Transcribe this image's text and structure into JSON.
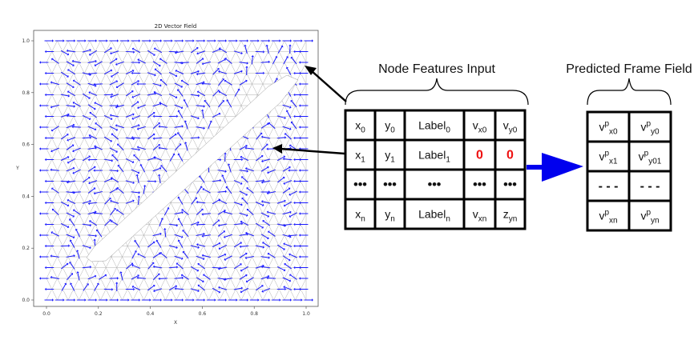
{
  "plot": {
    "title": "2D Vector Field",
    "xlabel": "X",
    "ylabel": "Y",
    "xticks": [
      "0.0",
      "0.2",
      "0.4",
      "0.6",
      "0.8",
      "1.0"
    ],
    "yticks": [
      "0.0",
      "0.2",
      "0.4",
      "0.6",
      "0.8",
      "1.0"
    ],
    "arrow_color": "#1a1aff",
    "mesh_color": "#9a9a9a"
  },
  "input_table": {
    "title": "Node Features Input",
    "rows": [
      [
        {
          "main": "x",
          "sub": "0"
        },
        {
          "main": "y",
          "sub": "0"
        },
        {
          "main": "Label",
          "sub": "0"
        },
        {
          "main": "v",
          "sub": "x0"
        },
        {
          "main": "v",
          "sub": "y0"
        }
      ],
      [
        {
          "main": "x",
          "sub": "1"
        },
        {
          "main": "y",
          "sub": "1"
        },
        {
          "main": "Label",
          "sub": "1"
        },
        {
          "main": "0",
          "red": true
        },
        {
          "main": "0",
          "red": true
        }
      ],
      [
        {
          "main": "•••",
          "dots": true
        },
        {
          "main": "•••",
          "dots": true
        },
        {
          "main": "•••",
          "dots": true
        },
        {
          "main": "•••",
          "dots": true
        },
        {
          "main": "•••",
          "dots": true
        }
      ],
      [
        {
          "main": "x",
          "sub": "n"
        },
        {
          "main": "y",
          "sub": "n"
        },
        {
          "main": "Label",
          "sub": "n"
        },
        {
          "main": "v",
          "sub": "xn"
        },
        {
          "main": "z",
          "sub": "yn"
        }
      ]
    ]
  },
  "output_table": {
    "title": "Predicted Frame Field",
    "rows": [
      [
        {
          "main": "v",
          "sup": "p",
          "sub": "x0"
        },
        {
          "main": "v",
          "sup": "p",
          "sub": "y0"
        }
      ],
      [
        {
          "main": "v",
          "sup": "p",
          "sub": "x1"
        },
        {
          "main": "v",
          "sup": "p",
          "sub": "y01"
        }
      ],
      [
        {
          "main": "- - -",
          "dots": true
        },
        {
          "main": "- - -",
          "dots": true
        }
      ],
      [
        {
          "main": "v",
          "sup": "p",
          "sub": "xn"
        },
        {
          "main": "v",
          "sup": "p",
          "sub": "yn"
        }
      ]
    ]
  },
  "colors": {
    "arrow_blue": "#0000ee",
    "highlight_red": "#ee1111"
  }
}
